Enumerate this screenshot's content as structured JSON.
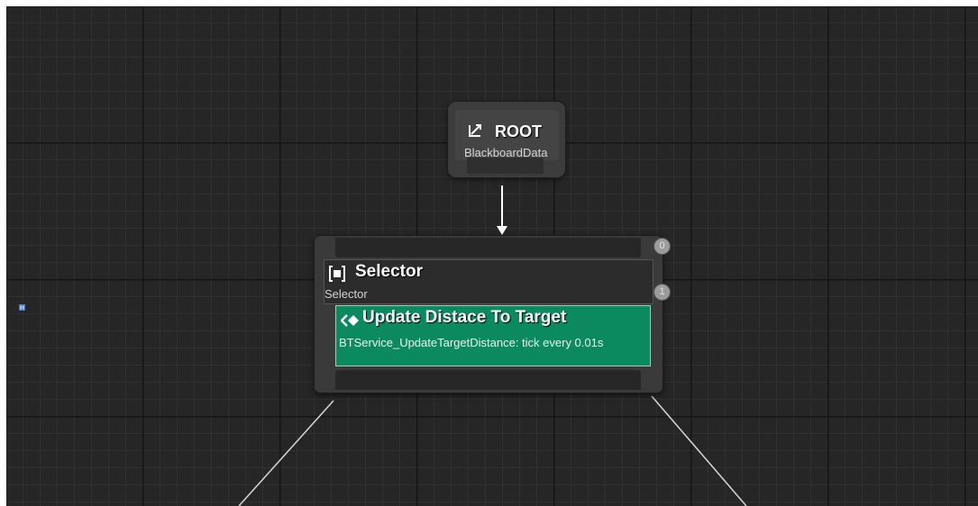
{
  "root": {
    "title": "ROOT",
    "subtitle": "BlackboardData",
    "icon": "root-arrow-icon"
  },
  "selector": {
    "title": "Selector",
    "subtitle": "Selector",
    "icon": "selector-bracket-icon"
  },
  "service": {
    "title": "Update Distace To Target",
    "description": "BTService_UpdateTargetDistance: tick every 0.01s",
    "icon": "service-diamond-icon",
    "color": "#0b8a5f"
  },
  "badges": [
    "0",
    "1"
  ],
  "colors": {
    "canvas": "#262626",
    "node": "#3a3a3a",
    "wire": "#ffffff"
  }
}
